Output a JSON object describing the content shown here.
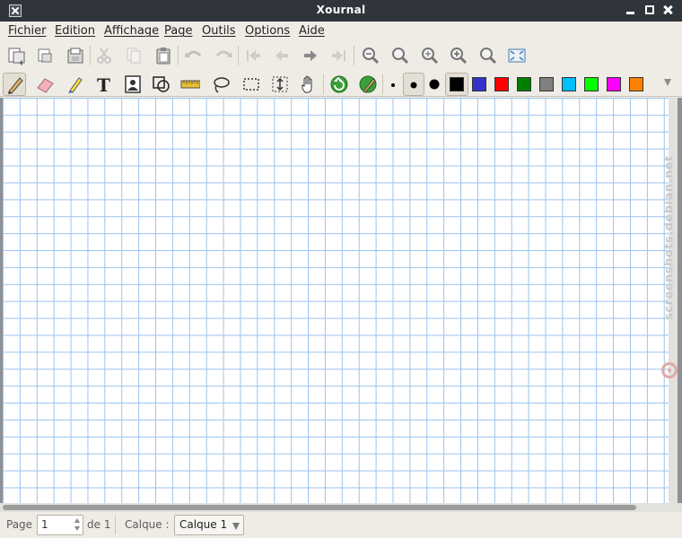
{
  "window": {
    "title": "Xournal"
  },
  "menu": {
    "items": [
      "Fichier",
      "Edition",
      "Affichage",
      "Page",
      "Outils",
      "Options",
      "Aide"
    ]
  },
  "toolbar1": {
    "buttons": [
      {
        "icon": "new-document-icon",
        "enabled": true
      },
      {
        "icon": "open-icon",
        "enabled": true
      },
      {
        "icon": "save-icon",
        "enabled": true
      },
      {
        "icon": "cut-icon",
        "enabled": false
      },
      {
        "icon": "copy-icon",
        "enabled": false
      },
      {
        "icon": "paste-icon",
        "enabled": true
      },
      {
        "icon": "undo-icon",
        "enabled": false
      },
      {
        "icon": "redo-icon",
        "enabled": false
      },
      {
        "icon": "first-page-icon",
        "enabled": false
      },
      {
        "icon": "previous-page-icon",
        "enabled": false
      },
      {
        "icon": "next-page-icon",
        "enabled": true
      },
      {
        "icon": "last-page-icon",
        "enabled": false
      },
      {
        "icon": "zoom-out-icon",
        "enabled": true
      },
      {
        "icon": "zoom-100-icon",
        "enabled": true
      },
      {
        "icon": "zoom-width-icon",
        "enabled": true
      },
      {
        "icon": "zoom-in-icon",
        "enabled": true
      },
      {
        "icon": "zoom-height-icon",
        "enabled": true
      },
      {
        "icon": "fullscreen-icon",
        "enabled": true
      }
    ]
  },
  "toolbar2": {
    "tools": [
      {
        "icon": "pen-icon",
        "active": true
      },
      {
        "icon": "eraser-icon",
        "active": false
      },
      {
        "icon": "highlighter-icon",
        "active": false
      },
      {
        "icon": "text-icon",
        "active": false
      },
      {
        "icon": "image-icon",
        "active": false
      },
      {
        "icon": "shape-recognizer-icon",
        "active": false
      },
      {
        "icon": "ruler-icon",
        "active": false
      },
      {
        "icon": "lasso-select-icon",
        "active": false
      },
      {
        "icon": "rect-select-icon",
        "active": false
      },
      {
        "icon": "vertical-space-icon",
        "active": false
      },
      {
        "icon": "hand-icon",
        "active": false
      },
      {
        "icon": "default-tool-icon",
        "active": false
      },
      {
        "icon": "default-pen-icon",
        "active": false
      }
    ],
    "thickness": [
      "fine",
      "medium",
      "thick"
    ],
    "selected_thickness": "medium",
    "colors": [
      "#000000",
      "#3333cc",
      "#ff0000",
      "#008000",
      "#808080",
      "#00c0ff",
      "#00ff00",
      "#ff00ff",
      "#ff8000"
    ],
    "selected_color": "#000000"
  },
  "canvas": {
    "watermark": "screenshots.debian.net",
    "grid_color": "#9cc3ee"
  },
  "status": {
    "page_label": "Page",
    "page_value": "1",
    "of_label": "de 1",
    "layer_label": "Calque :",
    "layer_value": "Calque 1"
  }
}
